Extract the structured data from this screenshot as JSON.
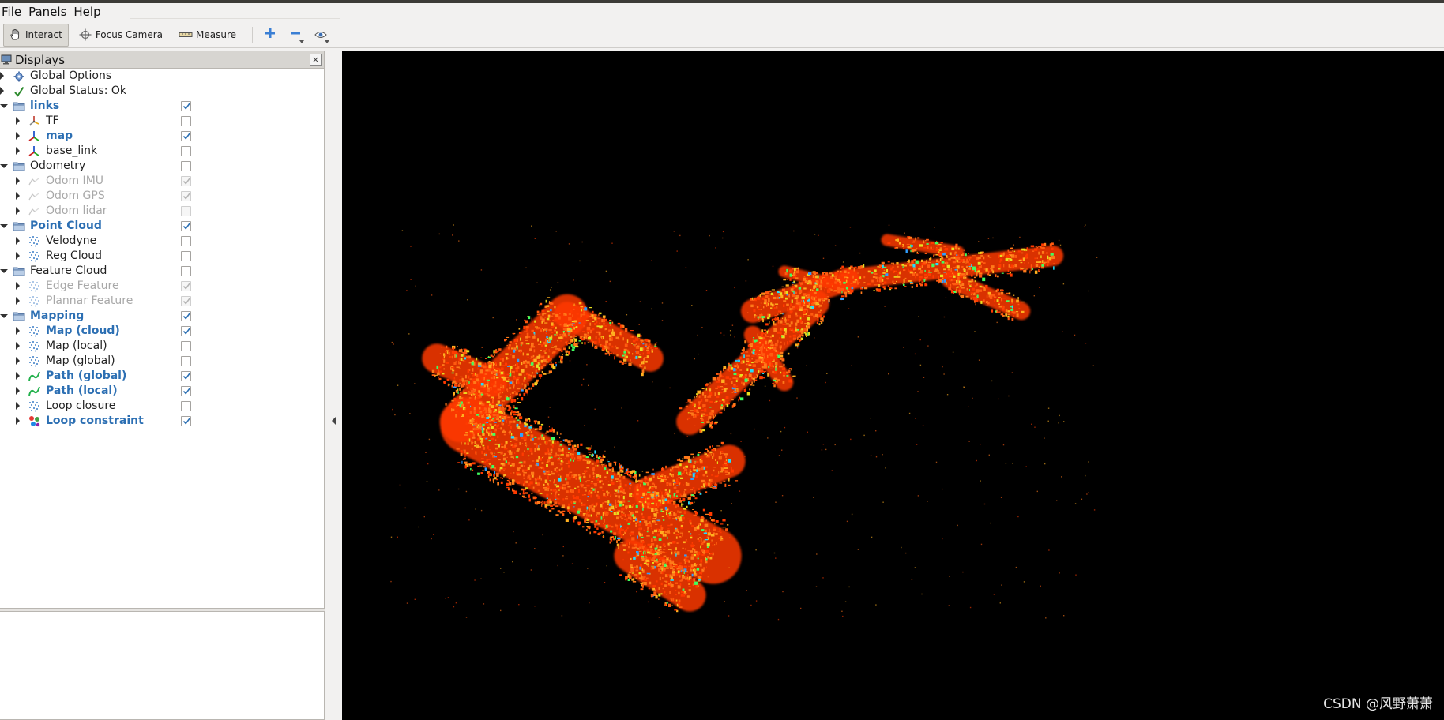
{
  "menu": {
    "file": "File",
    "panels": "Panels",
    "help": "Help"
  },
  "toolbar": {
    "interact": "Interact",
    "focus_camera": "Focus Camera",
    "measure": "Measure",
    "icons": [
      "hand-icon",
      "crosshair-icon",
      "ruler-icon",
      "plus-icon",
      "minus-icon",
      "eye-icon"
    ]
  },
  "displays": {
    "title": "Displays",
    "close": "×",
    "rows": [
      {
        "label": "Global Options",
        "level": 0,
        "arrow": "right",
        "icon": "gear-icon",
        "checkbox": "none",
        "style": "normal"
      },
      {
        "label": "Global Status: Ok",
        "level": 0,
        "arrow": "right",
        "icon": "check-icon",
        "checkbox": "none",
        "style": "normal"
      },
      {
        "label": "links",
        "level": 0,
        "arrow": "down",
        "icon": "folder-icon",
        "checkbox": "checked",
        "style": "bold"
      },
      {
        "label": "TF",
        "level": 1,
        "arrow": "right",
        "icon": "tf-icon",
        "checkbox": "unchecked",
        "style": "normal"
      },
      {
        "label": "map",
        "level": 1,
        "arrow": "right",
        "icon": "axes-icon",
        "checkbox": "checked",
        "style": "bold"
      },
      {
        "label": "base_link",
        "level": 1,
        "arrow": "right",
        "icon": "axes-icon",
        "checkbox": "unchecked",
        "style": "normal"
      },
      {
        "label": "Odometry",
        "level": 0,
        "arrow": "down",
        "icon": "folder-icon",
        "checkbox": "unchecked",
        "style": "normal"
      },
      {
        "label": "Odom IMU",
        "level": 1,
        "arrow": "right",
        "icon": "odometry-icon",
        "checkbox": "checked-dim",
        "style": "dim"
      },
      {
        "label": "Odom GPS",
        "level": 1,
        "arrow": "right",
        "icon": "odometry-icon",
        "checkbox": "checked-dim",
        "style": "dim"
      },
      {
        "label": "Odom lidar",
        "level": 1,
        "arrow": "right",
        "icon": "odometry-icon",
        "checkbox": "unchecked-dim",
        "style": "dim"
      },
      {
        "label": "Point Cloud",
        "level": 0,
        "arrow": "down",
        "icon": "folder-icon",
        "checkbox": "checked",
        "style": "bold"
      },
      {
        "label": "Velodyne",
        "level": 1,
        "arrow": "right",
        "icon": "pointcloud-icon",
        "checkbox": "unchecked",
        "style": "normal"
      },
      {
        "label": "Reg Cloud",
        "level": 1,
        "arrow": "right",
        "icon": "pointcloud-icon",
        "checkbox": "unchecked",
        "style": "normal"
      },
      {
        "label": "Feature Cloud",
        "level": 0,
        "arrow": "down",
        "icon": "folder-icon",
        "checkbox": "unchecked",
        "style": "normal"
      },
      {
        "label": "Edge Feature",
        "level": 1,
        "arrow": "right",
        "icon": "pointcloud-icon",
        "checkbox": "checked-dim",
        "style": "dim"
      },
      {
        "label": "Plannar Feature",
        "level": 1,
        "arrow": "right",
        "icon": "pointcloud-icon",
        "checkbox": "checked-dim",
        "style": "dim"
      },
      {
        "label": "Mapping",
        "level": 0,
        "arrow": "down",
        "icon": "folder-icon",
        "checkbox": "checked",
        "style": "bold"
      },
      {
        "label": "Map (cloud)",
        "level": 1,
        "arrow": "right",
        "icon": "pointcloud-icon",
        "checkbox": "checked",
        "style": "bold"
      },
      {
        "label": "Map (local)",
        "level": 1,
        "arrow": "right",
        "icon": "pointcloud-icon",
        "checkbox": "unchecked",
        "style": "normal"
      },
      {
        "label": "Map (global)",
        "level": 1,
        "arrow": "right",
        "icon": "pointcloud-icon",
        "checkbox": "unchecked",
        "style": "normal"
      },
      {
        "label": "Path (global)",
        "level": 1,
        "arrow": "right",
        "icon": "path-icon",
        "checkbox": "checked",
        "style": "bold"
      },
      {
        "label": "Path (local)",
        "level": 1,
        "arrow": "right",
        "icon": "path-icon",
        "checkbox": "checked",
        "style": "bold"
      },
      {
        "label": "Loop closure",
        "level": 1,
        "arrow": "right",
        "icon": "pointcloud-icon",
        "checkbox": "unchecked",
        "style": "normal"
      },
      {
        "label": "Loop constraint",
        "level": 1,
        "arrow": "right",
        "icon": "marker-icon",
        "checkbox": "checked",
        "style": "bold"
      }
    ]
  },
  "viewport": {
    "background": "#000000",
    "cloud_colors": [
      "#ff3a00",
      "#ff5a10",
      "#ff7a1a",
      "#ffb020",
      "#e8e020",
      "#40ff60",
      "#20e0ff",
      "#30a0ff"
    ],
    "watermark": "CSDN @风野萧萧"
  },
  "colors": {
    "bold_label": "#2c6fb3",
    "dim_label": "#a8a8a8",
    "checkmark": "#2c6fb3"
  }
}
